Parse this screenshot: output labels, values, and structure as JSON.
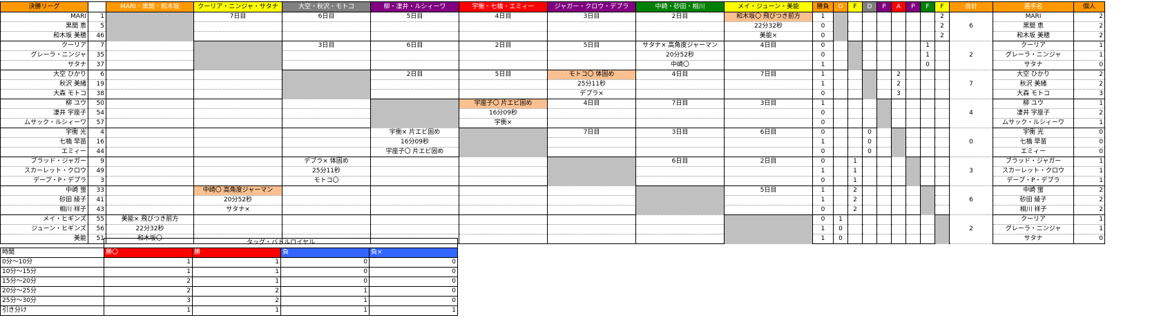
{
  "league": {
    "header": [
      "決勝リーグ",
      "",
      "MARI・黒間・和木坂",
      "クーリア・ニンジャ・サタナ",
      "大空・秋沢・モトコ",
      "柳・凄井・ルシィーワ",
      "宇衝・七橋・エミィー",
      "ジャガー・クロウ・デプラ",
      "中崎・砂田・相川",
      "メイ・ジューン・美能",
      "勝負",
      "O",
      "F",
      "D",
      "P",
      "A",
      "P",
      "F",
      "F",
      "合計",
      "選手名",
      "個人"
    ],
    "header_colors": [
      "#ff9900",
      "#ffffff",
      "#ff9900",
      "#ffff00",
      "#808080",
      "#800080",
      "#ff0000",
      "#800080",
      "#008000",
      "#ffff00",
      "#ff9900",
      "#ff9900",
      "#ffff00",
      "#808080",
      "#800080",
      "#ff0000",
      "#800080",
      "#008000",
      "#ffff00",
      "#ff9900",
      "#ff9900",
      "#ff9900"
    ],
    "header_text_colors": [
      "#000000",
      "#000000",
      "#ffffff",
      "#000000",
      "#ffffff",
      "#ffffff",
      "#ffffff",
      "#ffffff",
      "#ffffff",
      "#000000",
      "#000000",
      "#ffffff",
      "#000000",
      "#ffffff",
      "#ffffff",
      "#ffffff",
      "#ffffff",
      "#ffffff",
      "#000000",
      "#ffffff",
      "#ffffff",
      "#000000"
    ],
    "groups": [
      {
        "total": "6",
        "names": [
          "MARI",
          "黒間 恵",
          "和木坂 美穂"
        ],
        "nums": [
          "1",
          "5",
          "46"
        ],
        "stats": [
          [
            "1",
            "",
            "",
            "",
            "",
            "",
            "",
            "",
            "2"
          ],
          [
            "0",
            "",
            "",
            "",
            "",
            "",
            "",
            "",
            "2"
          ],
          [
            "0",
            "",
            "",
            "",
            "",
            "",
            "",
            "",
            "2"
          ]
        ],
        "players": [
          "MARI",
          "黒間 恵",
          "和木坂 美穂"
        ],
        "personal": [
          "2",
          "2",
          "2"
        ],
        "cells": [
          [
            "",
            "7日目",
            "6日目",
            "5日目",
            "4日目",
            "3日目",
            "2日目",
            "和木坂〇 飛びつき前方"
          ],
          [
            "",
            "",
            "",
            "",
            "",
            "",
            "",
            "22分32秒"
          ],
          [
            "",
            "",
            "",
            "",
            "",
            "",
            "",
            "美能×"
          ]
        ]
      },
      {
        "total": "2",
        "names": [
          "クーリア",
          "グレーラ・ニンジャ",
          "サタナ"
        ],
        "nums": [
          "7",
          "35",
          "37"
        ],
        "stats": [
          [
            "0",
            "",
            "",
            "",
            "",
            "",
            "",
            "1",
            ""
          ],
          [
            "0",
            "",
            "",
            "",
            "",
            "",
            "",
            "1",
            ""
          ],
          [
            "1",
            "",
            "",
            "",
            "",
            "",
            "",
            "0",
            ""
          ]
        ],
        "players": [
          "クーリア",
          "グレーラ・ニンジャ",
          "サタナ"
        ],
        "personal": [
          "1",
          "1",
          "0"
        ],
        "cells": [
          [
            "",
            "",
            "3日目",
            "6日目",
            "2日目",
            "5日目",
            "サタナ× 高角度ジャーマン",
            "4日目"
          ],
          [
            "",
            "",
            "",
            "",
            "",
            "",
            "20分52秒",
            ""
          ],
          [
            "",
            "",
            "",
            "",
            "",
            "",
            "中崎〇",
            ""
          ]
        ]
      },
      {
        "total": "7",
        "names": [
          "大空 ひかり",
          "秋沢 美緒",
          "大森 モトコ"
        ],
        "nums": [
          "6",
          "19",
          "38"
        ],
        "stats": [
          [
            "1",
            "",
            "",
            "",
            "",
            "2",
            "",
            "",
            ""
          ],
          [
            "1",
            "",
            "",
            "",
            "",
            "2",
            "",
            "",
            ""
          ],
          [
            "0",
            "",
            "",
            "",
            "",
            "3",
            "",
            "",
            ""
          ]
        ],
        "players": [
          "大空 ひかり",
          "秋沢 美緒",
          "大森 モトコ"
        ],
        "personal": [
          "2",
          "2",
          "3"
        ],
        "cells": [
          [
            "",
            "",
            "",
            "2日目",
            "5日目",
            "モトコ〇 体固め",
            "4日目",
            "7日目"
          ],
          [
            "",
            "",
            "",
            "",
            "",
            "25分11秒",
            "",
            ""
          ],
          [
            "",
            "",
            "",
            "",
            "",
            "デプラ×",
            "",
            ""
          ]
        ]
      },
      {
        "total": "4",
        "names": [
          "柳 ユウ",
          "凄井 宇座子",
          "ムサック・ルシィーワ"
        ],
        "nums": [
          "50",
          "54",
          "57"
        ],
        "stats": [
          [
            "1",
            "",
            "",
            "",
            "1",
            "",
            "",
            "",
            ""
          ],
          [
            "0",
            "",
            "",
            "",
            "2",
            "",
            "",
            "",
            ""
          ],
          [
            "0",
            "",
            "",
            "",
            "1",
            "",
            "",
            "",
            ""
          ]
        ],
        "players": [
          "柳 ユウ",
          "凄井 宇座子",
          "ムサック・ルシィーワ"
        ],
        "personal": [
          "1",
          "2",
          "1"
        ],
        "cells": [
          [
            "",
            "",
            "",
            "",
            "宇座子〇 片エビ固め",
            "4日目",
            "7日目",
            "3日目"
          ],
          [
            "",
            "",
            "",
            "",
            "16分09秒",
            "",
            "",
            ""
          ],
          [
            "",
            "",
            "",
            "",
            "宇衝×",
            "",
            "",
            ""
          ]
        ]
      },
      {
        "total": "0",
        "names": [
          "宇衝 光",
          "七橋 早苗",
          "エミィー"
        ],
        "nums": [
          "4",
          "16",
          "44"
        ],
        "stats": [
          [
            "0",
            "",
            "",
            "0",
            "",
            "",
            "",
            "",
            ""
          ],
          [
            "1",
            "",
            "",
            "0",
            "",
            "",
            "",
            "",
            ""
          ],
          [
            "0",
            "",
            "",
            "0",
            "",
            "",
            "",
            "",
            ""
          ]
        ],
        "players": [
          "宇衝 光",
          "七橋 早苗",
          "エミィー"
        ],
        "personal": [
          "0",
          "0",
          "0"
        ],
        "cells": [
          [
            "",
            "",
            "",
            "宇衝× 片エビ固め",
            "",
            "7日目",
            "3日目",
            "6日目"
          ],
          [
            "",
            "",
            "",
            "16分09秒",
            "",
            "",
            "",
            ""
          ],
          [
            "",
            "",
            "",
            "宇座子〇 片エビ固め",
            "",
            "",
            "",
            ""
          ]
        ]
      },
      {
        "total": "3",
        "names": [
          "ブラッド・ジャガー",
          "スカーレット・クロウ",
          "デープ・P・デプラ"
        ],
        "nums": [
          "9",
          "49",
          "3"
        ],
        "stats": [
          [
            "0",
            "",
            "1",
            "",
            "",
            "",
            "",
            "",
            ""
          ],
          [
            "1",
            "",
            "1",
            "",
            "",
            "",
            "",
            "",
            ""
          ],
          [
            "0",
            "",
            "1",
            "",
            "",
            "",
            "",
            "",
            ""
          ]
        ],
        "players": [
          "ブラッド・ジャガー",
          "スカーレット・クロウ",
          "デープ・P・デプラ"
        ],
        "personal": [
          "1",
          "1",
          "1"
        ],
        "cells": [
          [
            "",
            "",
            "デプラ× 体固め",
            "",
            "",
            "",
            "6日目",
            "2日目"
          ],
          [
            "",
            "",
            "25分11秒",
            "",
            "",
            "",
            "",
            ""
          ],
          [
            "",
            "",
            "モトコ〇",
            "",
            "",
            "",
            "",
            ""
          ]
        ]
      },
      {
        "total": "6",
        "names": [
          "中崎 蛍",
          "砂田 綾子",
          "相川 祥子"
        ],
        "nums": [
          "33",
          "41",
          "43"
        ],
        "stats": [
          [
            "1",
            "",
            "2",
            "",
            "",
            "",
            "",
            "",
            ""
          ],
          [
            "1",
            "",
            "2",
            "",
            "",
            "",
            "",
            "",
            ""
          ],
          [
            "0",
            "",
            "2",
            "",
            "",
            "",
            "",
            "",
            ""
          ]
        ],
        "players": [
          "中崎 蛍",
          "砂田 綾子",
          "相川 祥子"
        ],
        "personal": [
          "2",
          "2",
          "2"
        ],
        "cells": [
          [
            "",
            "中崎〇 高角度ジャーマン",
            "",
            "",
            "",
            "",
            "",
            "5日目"
          ],
          [
            "",
            "20分52秒",
            "",
            "",
            "",
            "",
            "",
            ""
          ],
          [
            "",
            "サタナ×",
            "",
            "",
            "",
            "",
            "",
            ""
          ]
        ]
      },
      {
        "total": "2",
        "names": [
          "メイ・ヒギンズ",
          "ジューン・ヒギンズ",
          "美能"
        ],
        "nums": [
          "55",
          "56",
          "51"
        ],
        "stats": [
          [
            "0",
            "1",
            "",
            "",
            "",
            "",
            "",
            "",
            ""
          ],
          [
            "1",
            "0",
            "",
            "",
            "",
            "",
            "",
            "",
            ""
          ],
          [
            "1",
            "0",
            "",
            "",
            "",
            "",
            "",
            "",
            ""
          ]
        ],
        "players": [
          "クーリア",
          "グレーラ・ニンジャ",
          "サタナ"
        ],
        "personal": [
          "1",
          "1",
          "0"
        ],
        "cells": [
          [
            "美能× 飛びつき前方",
            "",
            "",
            "",
            "",
            "",
            "",
            ""
          ],
          [
            "22分32秒",
            "",
            "",
            "",
            "",
            "",
            "",
            ""
          ],
          [
            "和木坂〇",
            "",
            "",
            "",
            "",
            "",
            "",
            ""
          ]
        ]
      }
    ]
  },
  "stats": {
    "title": "タッグ・バトルロイヤル",
    "time_label": "時間",
    "cols": [
      "勝〇",
      "勝",
      "負",
      "負×"
    ],
    "col_colors": [
      "#ff0000",
      "#ff0000",
      "#3366ff",
      "#3366ff"
    ],
    "rows": [
      {
        "label": "0分～10分",
        "values": [
          "1",
          "1",
          "0",
          "0"
        ]
      },
      {
        "label": "10分～15分",
        "values": [
          "1",
          "1",
          "0",
          "0"
        ]
      },
      {
        "label": "15分～20分",
        "values": [
          "2",
          "1",
          "0",
          "0"
        ]
      },
      {
        "label": "20分～25分",
        "values": [
          "2",
          "2",
          "1",
          "0"
        ]
      },
      {
        "label": "25分～30分",
        "values": [
          "3",
          "2",
          "1",
          "0"
        ]
      },
      {
        "label": "引き分け",
        "values": [
          "1",
          "1",
          "1",
          "1"
        ]
      }
    ]
  }
}
